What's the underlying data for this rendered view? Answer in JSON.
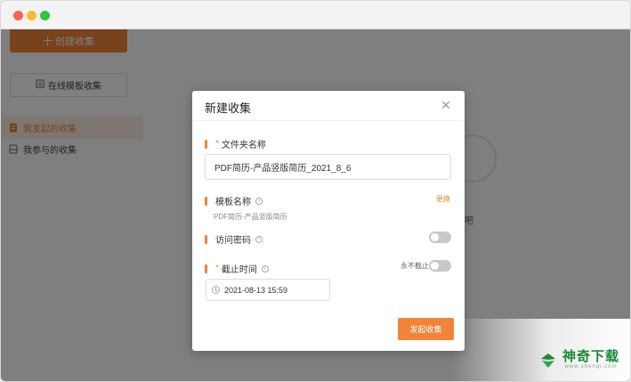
{
  "sidebar": {
    "create_label": "十 创建收集",
    "template_label": "在线模板收集",
    "items": [
      {
        "label": "我发起的收集"
      },
      {
        "label": "我参与的收集"
      }
    ]
  },
  "background": {
    "partial_text": "吧"
  },
  "modal": {
    "title": "新建收集",
    "folder_label": "文件夹名称",
    "folder_required": "*",
    "folder_value": "PDF简历-产品竖版简历_2021_8_6",
    "template_label": "模板名称",
    "template_change": "更换",
    "template_value": "PDF简历-产品竖版简历",
    "password_label": "访问密码",
    "password_enabled": false,
    "deadline_label": "截止时间",
    "deadline_required": "*",
    "deadline_never_label": "永不截止",
    "deadline_never_enabled": false,
    "deadline_value": "2021-08-13 15:59",
    "submit_label": "发起收集"
  },
  "watermark": {
    "main": "神奇下载",
    "sub": "www.shenqi.com"
  },
  "colors": {
    "accent": "#f0843a",
    "overlay": "rgba(0,0,0,0.5)",
    "brand_green": "#1c8a3a"
  }
}
